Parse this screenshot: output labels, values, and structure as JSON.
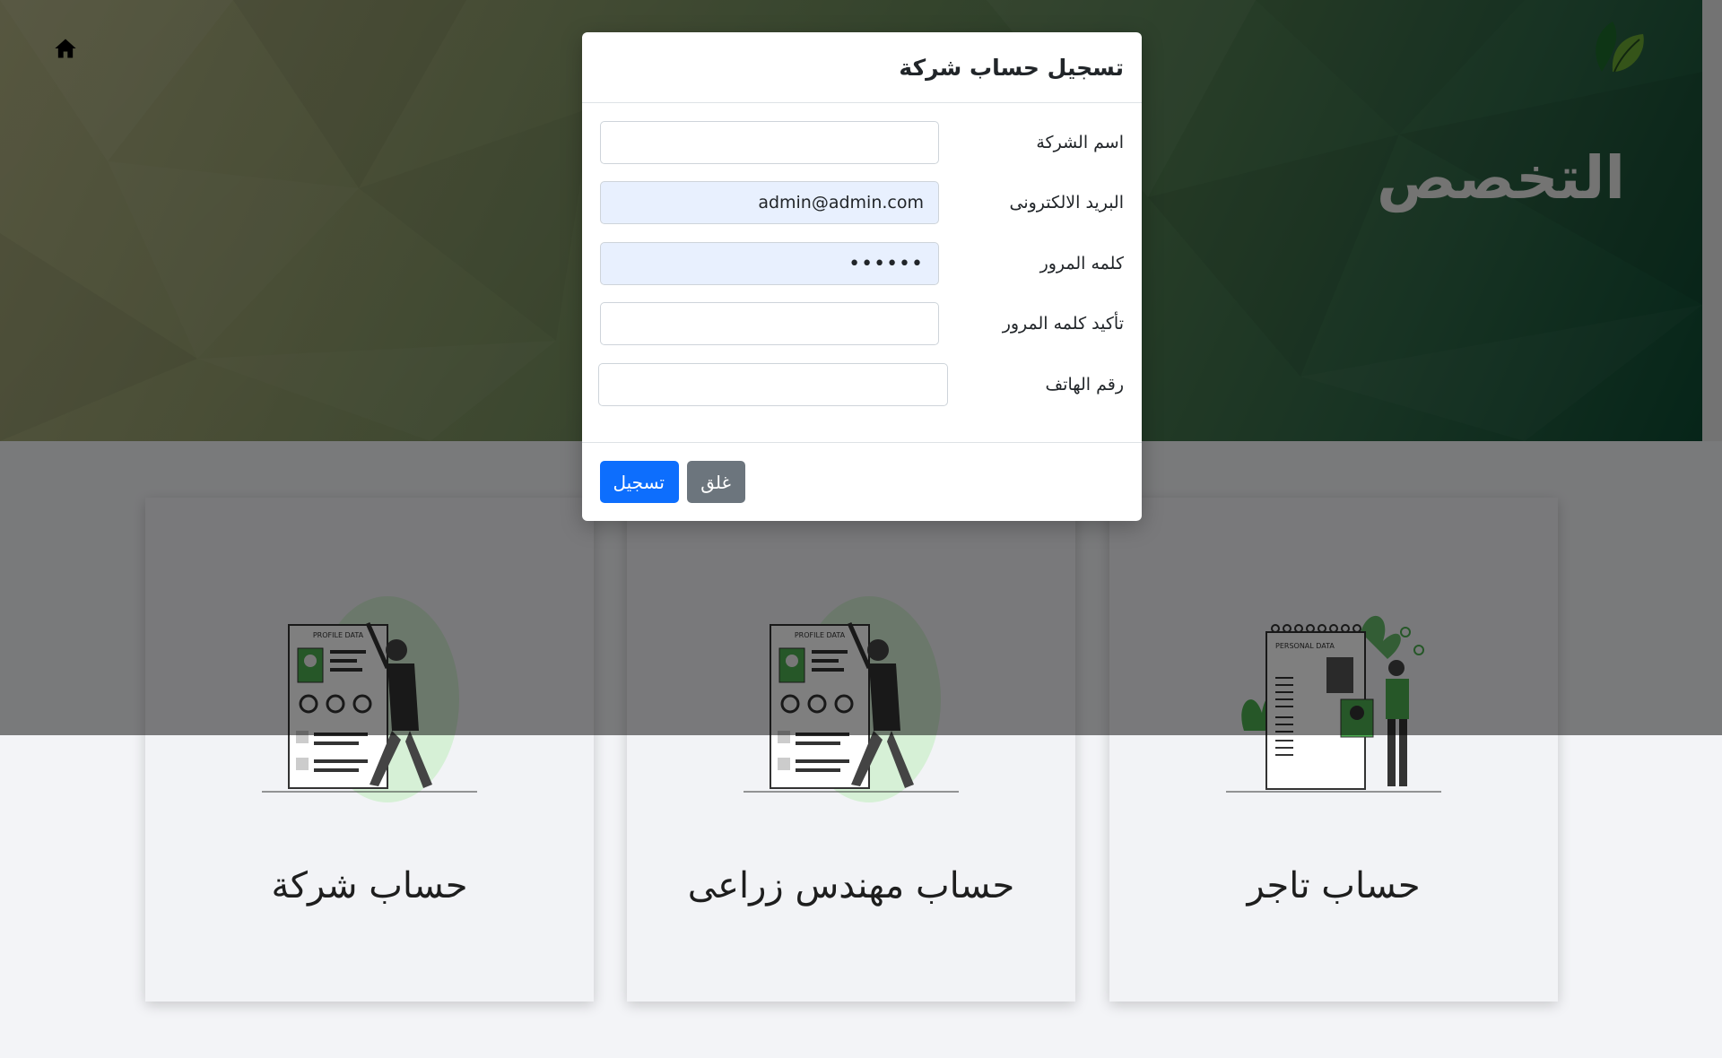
{
  "hero": {
    "title": "التخصص",
    "home_icon": "home-icon",
    "logo_icon": "leaf-logo-icon"
  },
  "cards": [
    {
      "title": "حساب شركة",
      "illustration": "profile-data-illustration"
    },
    {
      "title": "حساب مهندس زراعى",
      "illustration": "profile-data-illustration"
    },
    {
      "title": "حساب تاجر",
      "illustration": "personal-data-illustration"
    }
  ],
  "modal": {
    "title": "تسجيل حساب شركة",
    "fields": [
      {
        "label": "اسم الشركة",
        "value": "",
        "placeholder": ""
      },
      {
        "label": "البريد الالكترونى",
        "value": "admin@admin.com",
        "placeholder": ""
      },
      {
        "label": "كلمه المرور",
        "value": "••••••",
        "placeholder": ""
      },
      {
        "label": "تأكيد كلمه المرور",
        "value": "",
        "placeholder": ""
      },
      {
        "label": "رقم الهاتف",
        "value": "",
        "placeholder": ""
      }
    ],
    "buttons": {
      "submit": "تسجيل",
      "close": "غلق"
    }
  },
  "colors": {
    "primary": "#0d6efd",
    "secondary": "#6c757d",
    "autofill": "#e8f0fe",
    "hero_dark": "#0d4a32",
    "leaf_green": "#2e8b3a"
  }
}
